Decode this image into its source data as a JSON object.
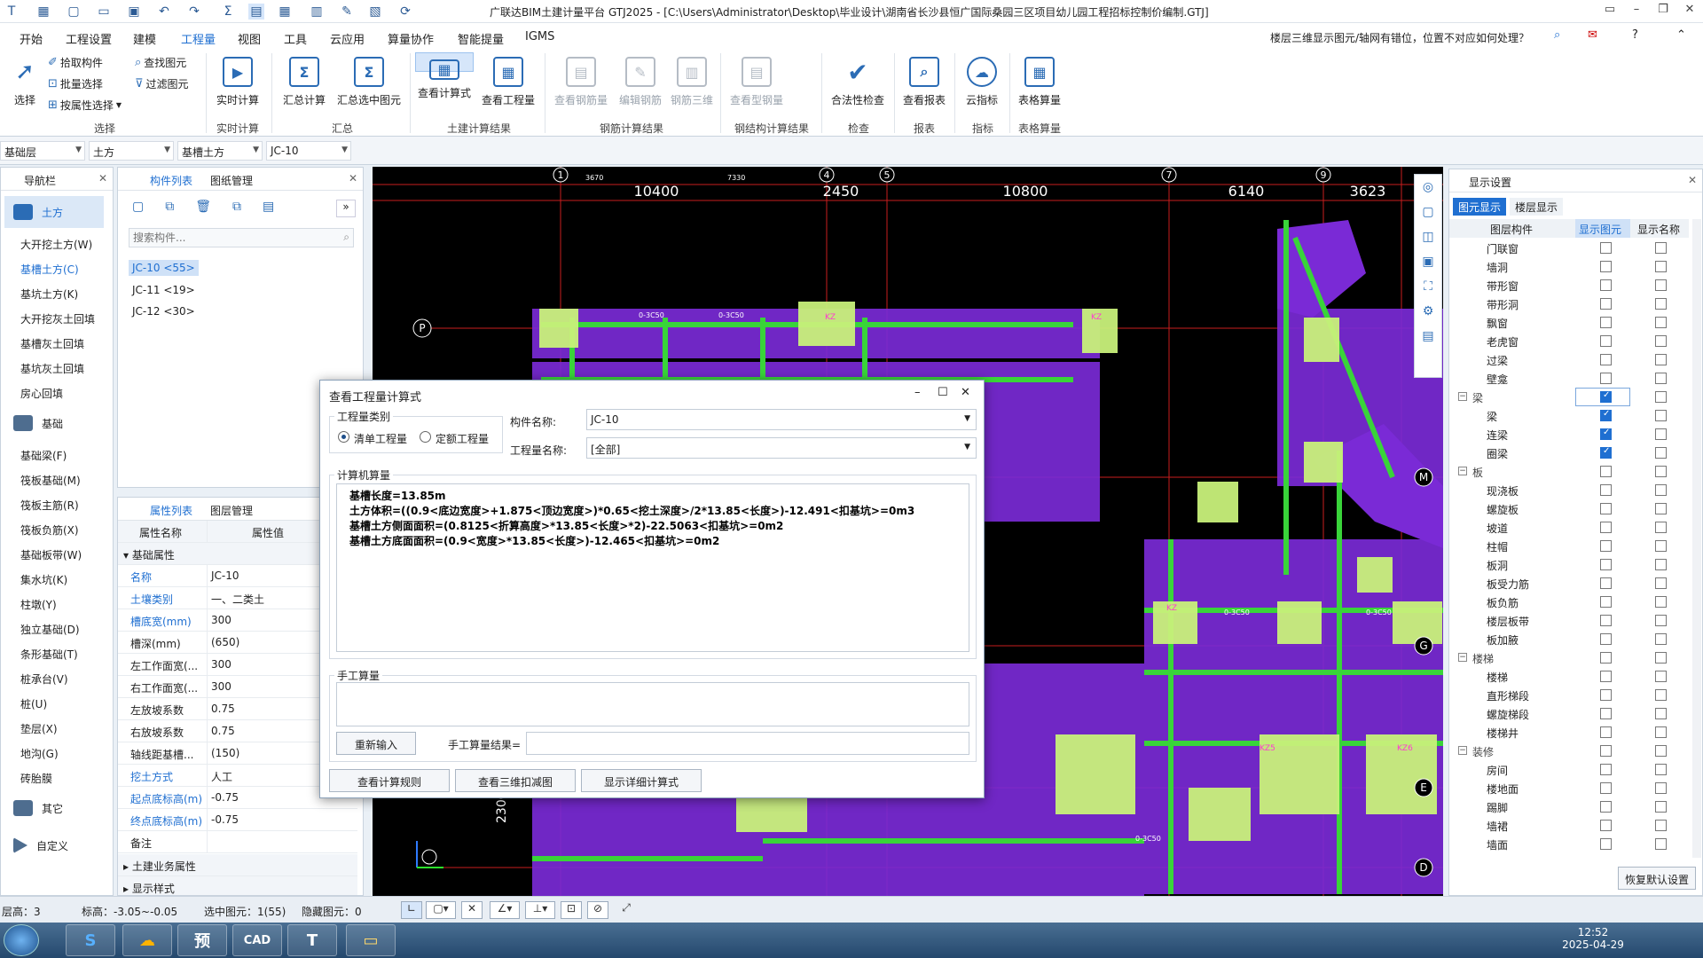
{
  "window": {
    "title": "广联达BIM土建计量平台 GTJ2025 - [C:\\Users\\Administrator\\Desktop\\毕业设计\\湖南省长沙县恒广国际桑园三区项目幼儿园工程招标控制价编制.GTJ]"
  },
  "menu": {
    "items": [
      "开始",
      "工程设置",
      "建模",
      "工程量",
      "视图",
      "工具",
      "云应用",
      "算量协作",
      "智能提量",
      "IGMS"
    ],
    "help_question": "楼层三维显示图元/轴网有错位，位置不对应如何处理？"
  },
  "ribbon": {
    "select": {
      "select_label": "选择",
      "pick": "拾取构件",
      "batch": "批量选择",
      "by_attr": "按属性选择",
      "find": "查找图元",
      "filter": "过滤图元",
      "group": "选择"
    },
    "realtime": {
      "calc": "实时计算",
      "group": "实时计算"
    },
    "summary": {
      "calc": "汇总计算",
      "calc_selected": "汇总选中图元",
      "group": "汇总"
    },
    "earthwork": {
      "view_formula": "查看计算式",
      "view_quantity": "查看工程量",
      "group": "土建计算结果"
    },
    "rebar": {
      "view_rebar": "查看钢筋量",
      "edit_rebar": "编辑钢筋",
      "rebar_3d": "钢筋三维",
      "group": "钢筋计算结果"
    },
    "steel": {
      "view_steel": "查看型钢量",
      "group": "钢结构计算结果"
    },
    "check": {
      "legal": "合法性检查",
      "group": "检查"
    },
    "report": {
      "view": "查看报表",
      "group": "报表"
    },
    "index": {
      "cloud": "云指标",
      "group": "指标"
    },
    "table": {
      "calc": "表格算量",
      "group": "表格算量"
    }
  },
  "selectors": {
    "floor": "基础层",
    "category": "土方",
    "type": "基槽土方",
    "component": "JC-10"
  },
  "nav": {
    "title": "导航栏",
    "categories": {
      "earth": "土方",
      "foundation": "基础",
      "other": "其它",
      "custom": "自定义"
    },
    "earth_items": [
      "大开挖土方(W)",
      "基槽土方(C)",
      "基坑土方(K)",
      "大开挖灰土回填",
      "基槽灰土回填",
      "基坑灰土回填",
      "房心回填"
    ],
    "foundation_items": [
      "基础梁(F)",
      "筏板基础(M)",
      "筏板主筋(R)",
      "筏板负筋(X)",
      "基础板带(W)",
      "集水坑(K)",
      "柱墩(Y)",
      "独立基础(D)",
      "条形基础(T)",
      "桩承台(V)",
      "桩(U)",
      "垫层(X)",
      "地沟(G)",
      "砖胎膜"
    ]
  },
  "component_list": {
    "tab1": "构件列表",
    "tab2": "图纸管理",
    "search_placeholder": "搜索构件...",
    "items": [
      "JC-10 <55>",
      "JC-11 <19>",
      "JC-12 <30>"
    ]
  },
  "properties": {
    "tab1": "属性列表",
    "tab2": "图层管理",
    "col_name": "属性名称",
    "col_value": "属性值",
    "group_basic": "基础属性",
    "rows": [
      {
        "k": "名称",
        "v": "JC-10"
      },
      {
        "k": "土壤类别",
        "v": "一、二类土"
      },
      {
        "k": "槽底宽(mm)",
        "v": "300"
      },
      {
        "k": "槽深(mm)",
        "v": "(650)"
      },
      {
        "k": "左工作面宽(...",
        "v": "300"
      },
      {
        "k": "右工作面宽(...",
        "v": "300"
      },
      {
        "k": "左放坡系数",
        "v": "0.75"
      },
      {
        "k": "右放坡系数",
        "v": "0.75"
      },
      {
        "k": "轴线距基槽...",
        "v": "(150)"
      },
      {
        "k": "挖土方式",
        "v": "人工"
      },
      {
        "k": "起点底标高(m)",
        "v": "-0.75"
      },
      {
        "k": "终点底标高(m)",
        "v": "-0.75"
      },
      {
        "k": "备注",
        "v": ""
      }
    ],
    "group_business": "土建业务属性",
    "group_display": "显示样式"
  },
  "canvas": {
    "axes": [
      "1",
      "4",
      "5",
      "7",
      "9"
    ],
    "dims": [
      "10400",
      "2450",
      "10800",
      "6140",
      "3623"
    ],
    "small_dims": [
      "3670",
      "7330"
    ],
    "row_labels": [
      "P",
      "M",
      "G",
      "E",
      "D"
    ],
    "kz_labels": [
      "KZ",
      "KZ",
      "KZ",
      "KZ5",
      "KZ6"
    ],
    "beam_label": "0-3C50",
    "bottom_dim": "2300"
  },
  "display": {
    "title": "显示设置",
    "tab1": "图元显示",
    "tab2": "楼层显示",
    "col_component": "图层构件",
    "col_show": "显示图元",
    "col_name": "显示名称",
    "reset": "恢复默认设置",
    "rows": [
      {
        "n": "门联窗",
        "g": false,
        "s": false
      },
      {
        "n": "墙洞",
        "g": false,
        "s": false
      },
      {
        "n": "带形窗",
        "g": false,
        "s": false
      },
      {
        "n": "带形洞",
        "g": false,
        "s": false
      },
      {
        "n": "飘窗",
        "g": false,
        "s": false
      },
      {
        "n": "老虎窗",
        "g": false,
        "s": false
      },
      {
        "n": "过梁",
        "g": false,
        "s": false
      },
      {
        "n": "壁龛",
        "g": false,
        "s": false
      },
      {
        "n": "梁",
        "g": true,
        "s": true
      },
      {
        "n": "梁",
        "g": false,
        "s": true
      },
      {
        "n": "连梁",
        "g": false,
        "s": true
      },
      {
        "n": "圈梁",
        "g": false,
        "s": true
      },
      {
        "n": "板",
        "g": true,
        "s": false
      },
      {
        "n": "现浇板",
        "g": false,
        "s": false
      },
      {
        "n": "螺旋板",
        "g": false,
        "s": false
      },
      {
        "n": "坡道",
        "g": false,
        "s": false
      },
      {
        "n": "柱帽",
        "g": false,
        "s": false
      },
      {
        "n": "板洞",
        "g": false,
        "s": false
      },
      {
        "n": "板受力筋",
        "g": false,
        "s": false
      },
      {
        "n": "板负筋",
        "g": false,
        "s": false
      },
      {
        "n": "楼层板带",
        "g": false,
        "s": false
      },
      {
        "n": "板加腋",
        "g": false,
        "s": false
      },
      {
        "n": "楼梯",
        "g": true,
        "s": false
      },
      {
        "n": "楼梯",
        "g": false,
        "s": false
      },
      {
        "n": "直形梯段",
        "g": false,
        "s": false
      },
      {
        "n": "螺旋梯段",
        "g": false,
        "s": false
      },
      {
        "n": "楼梯井",
        "g": false,
        "s": false
      },
      {
        "n": "装修",
        "g": true,
        "s": false
      },
      {
        "n": "房间",
        "g": false,
        "s": false
      },
      {
        "n": "楼地面",
        "g": false,
        "s": false
      },
      {
        "n": "踢脚",
        "g": false,
        "s": false
      },
      {
        "n": "墙裙",
        "g": false,
        "s": false
      },
      {
        "n": "墙面",
        "g": false,
        "s": false
      }
    ]
  },
  "dialog": {
    "title": "查看工程量计算式",
    "qty_type_label": "工程量类别",
    "radio1": "清单工程量",
    "radio2": "定额工程量",
    "comp_name_label": "构件名称:",
    "comp_name": "JC-10",
    "qty_name_label": "工程量名称:",
    "qty_name": "[全部]",
    "computer_label": "计算机算量",
    "formulas": [
      "基槽长度=13.85m",
      "土方体积=((0.9<底边宽度>+1.875<顶边宽度>)*0.65<挖土深度>/2*13.85<长度>)-12.491<扣基坑>=0m3",
      "基槽土方侧面面积=(0.8125<折算高度>*13.85<长度>*2)-22.5063<扣基坑>=0m2",
      "基槽土方底面面积=(0.9<宽度>*13.85<长度>)-12.465<扣基坑>=0m2"
    ],
    "manual_label": "手工算量",
    "reenter": "重新输入",
    "manual_result_label": "手工算量结果=",
    "btn_rules": "查看计算规则",
    "btn_3d": "查看三维扣减图",
    "btn_detail": "显示详细计算式"
  },
  "status": {
    "floor_h": "层高：3",
    "elev": "标高：-3.05~-0.05",
    "selected": "选中图元：1(55)",
    "hidden": "隐藏图元：0"
  },
  "taskbar": {
    "time": "12:52",
    "date": "2025-04-29"
  },
  "colors": {
    "accent": "#1f6fd1",
    "canvas_bg": "#000000",
    "beam": "#7a2ad6",
    "green": "#39d439",
    "column": "#c8f07a",
    "axis_red": "#c81e1e"
  }
}
